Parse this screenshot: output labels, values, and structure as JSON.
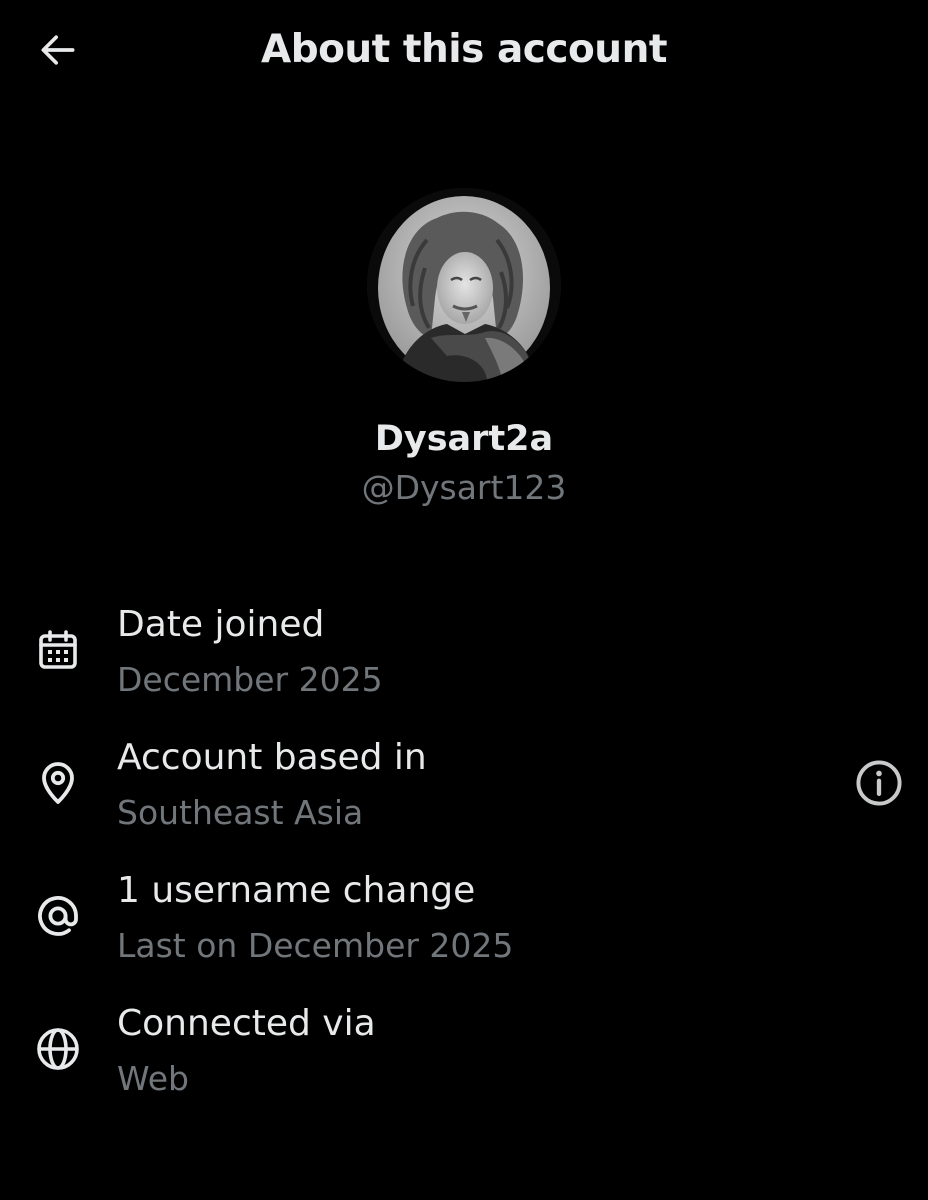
{
  "header": {
    "title": "About this account",
    "back_icon": "arrow-left-icon"
  },
  "profile": {
    "display_name": "Dysart2a",
    "handle": "@Dysart123",
    "avatar_description": "portrait-avatar"
  },
  "details": [
    {
      "icon": "calendar-icon",
      "label": "Date joined",
      "value": "December 2025"
    },
    {
      "icon": "location-pin-icon",
      "label": "Account based in",
      "value": "Southeast Asia",
      "action_icon": "info-icon"
    },
    {
      "icon": "at-sign-icon",
      "label": "1 username change",
      "value": "Last on December 2025"
    },
    {
      "icon": "globe-icon",
      "label": "Connected via",
      "value": "Web"
    }
  ],
  "colors": {
    "background": "#000000",
    "primary_text": "#e7e9ea",
    "secondary_text": "#71767b"
  }
}
